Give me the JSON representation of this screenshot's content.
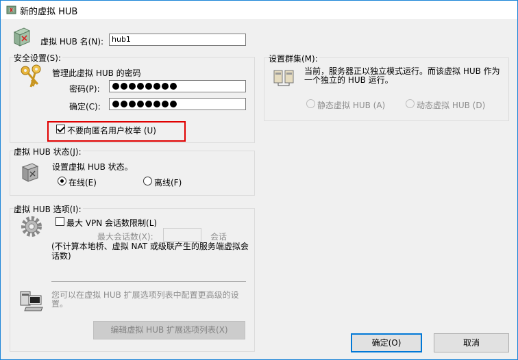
{
  "window": {
    "title": "新的虚拟 HUB"
  },
  "hub_name": {
    "label": "虚拟 HUB 名(N):",
    "value": "hub1"
  },
  "security": {
    "group_label": "安全设置(S):",
    "heading": "管理此虚拟 HUB 的密码",
    "password_label": "密码(P):",
    "confirm_label": "确定(C):",
    "anon_checkbox_label": "不要向匿名用户枚举 (U)",
    "password_masked_count": 8
  },
  "cluster": {
    "group_label": "设置群集(M):",
    "description": "当前，服务器正以独立模式运行。而该虚拟 HUB 作为一个独立的 HUB 运行。",
    "static_label": "静态虚拟 HUB (A)",
    "dynamic_label": "动态虚拟 HUB (D)"
  },
  "status": {
    "group_label": "虚拟 HUB 状态(J):",
    "heading": "设置虚拟 HUB 状态。",
    "online_label": "在线(E)",
    "offline_label": "离线(F)"
  },
  "options": {
    "group_label": "虚拟 HUB 选项(I):",
    "max_vpn_label": "最大 VPN 会话数限制(L)",
    "max_sessions_label": "最大会话数(X):",
    "max_sessions_unit": "会话",
    "note": "(不计算本地桥、虚拟 NAT 或级联产生的服务端虚拟会话数)",
    "ext_hint": "您可以在虚拟 HUB 扩展选项列表中配置更高级的设置。",
    "ext_button": "编辑虚拟 HUB 扩展选项列表(X)"
  },
  "buttons": {
    "ok": "确定(O)",
    "cancel": "取消"
  },
  "colors": {
    "accent": "#0078d7",
    "highlight": "#e00000"
  }
}
